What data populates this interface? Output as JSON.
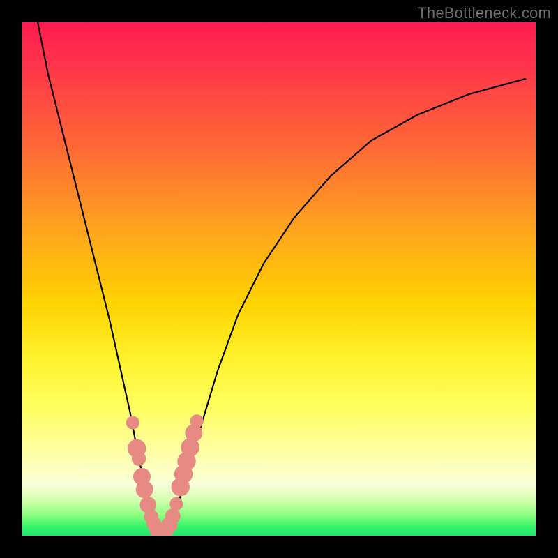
{
  "watermark": "TheBottleneck.com",
  "chart_data": {
    "type": "line",
    "title": "",
    "xlabel": "",
    "ylabel": "",
    "xlim": [
      0,
      100
    ],
    "ylim": [
      0,
      100
    ],
    "series": [
      {
        "name": "bottleneck-curve",
        "x": [
          3,
          5,
          8,
          11,
          14,
          17,
          19,
          21,
          22.5,
          24,
          25,
          26,
          27,
          28,
          30,
          32,
          35,
          38,
          42,
          47,
          53,
          60,
          68,
          77,
          87,
          98
        ],
        "y": [
          100,
          90,
          78,
          66,
          54,
          42,
          33,
          24,
          16,
          9,
          4,
          1,
          0,
          1,
          5,
          12,
          22,
          32,
          43,
          53,
          62,
          70,
          77,
          82,
          86,
          89
        ]
      }
    ],
    "markers": {
      "name": "highlighted-points",
      "color": "#e88a84",
      "points": [
        {
          "x": 21.5,
          "y": 22,
          "r": 1.3
        },
        {
          "x": 22.3,
          "y": 17,
          "r": 1.8
        },
        {
          "x": 22.7,
          "y": 15,
          "r": 1.4
        },
        {
          "x": 23.3,
          "y": 11.5,
          "r": 1.7
        },
        {
          "x": 23.8,
          "y": 9,
          "r": 1.7
        },
        {
          "x": 24.5,
          "y": 6,
          "r": 1.6
        },
        {
          "x": 25.1,
          "y": 3.7,
          "r": 1.4
        },
        {
          "x": 25.6,
          "y": 2.4,
          "r": 1.4
        },
        {
          "x": 26.2,
          "y": 1.2,
          "r": 1.5
        },
        {
          "x": 27.0,
          "y": 0.5,
          "r": 1.5
        },
        {
          "x": 27.8,
          "y": 0.7,
          "r": 1.5
        },
        {
          "x": 28.6,
          "y": 2.0,
          "r": 1.6
        },
        {
          "x": 29.3,
          "y": 3.8,
          "r": 1.5
        },
        {
          "x": 30.0,
          "y": 6.2,
          "r": 1.3
        },
        {
          "x": 30.8,
          "y": 9.5,
          "r": 1.8
        },
        {
          "x": 31.4,
          "y": 12,
          "r": 1.8
        },
        {
          "x": 32.0,
          "y": 14.5,
          "r": 1.8
        },
        {
          "x": 32.7,
          "y": 17.2,
          "r": 1.8
        },
        {
          "x": 33.4,
          "y": 20,
          "r": 1.7
        },
        {
          "x": 34.0,
          "y": 22.3,
          "r": 1.3
        }
      ]
    },
    "curve_stroke": "#000000",
    "curve_width": 2.2
  }
}
